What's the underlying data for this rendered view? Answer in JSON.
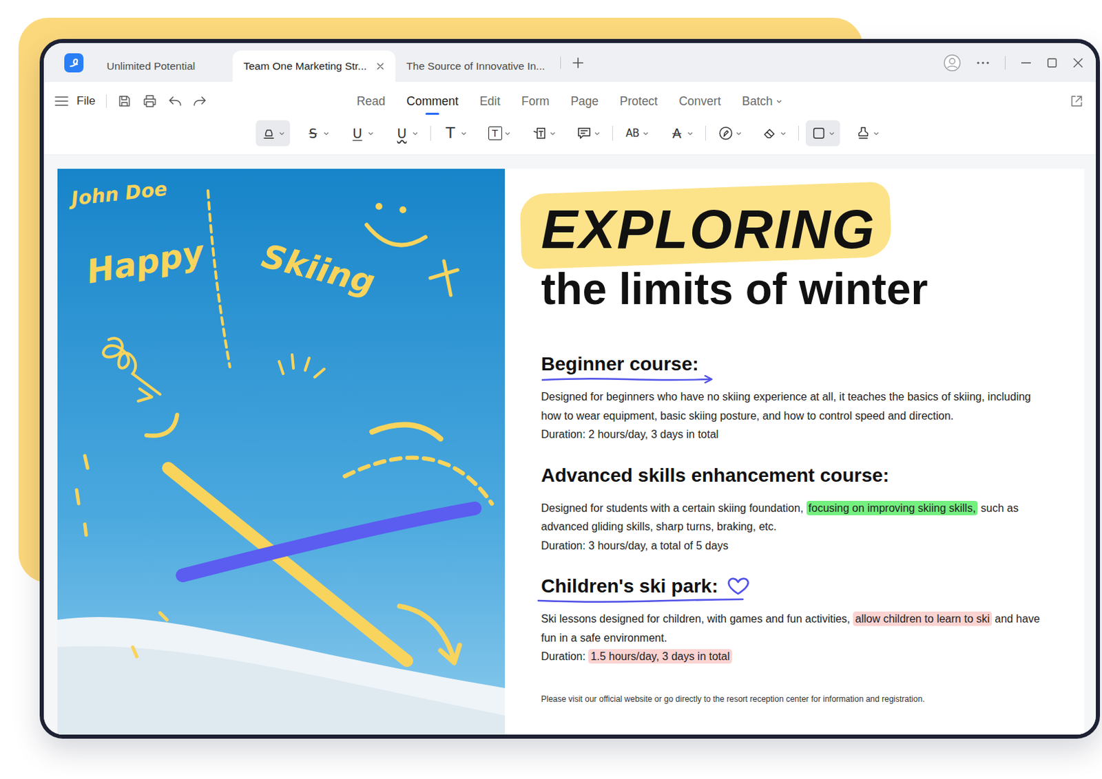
{
  "tabs": [
    {
      "label": "Unlimited Potential",
      "selected": false,
      "closable": false
    },
    {
      "label": "Team One Marketing Str...",
      "selected": true,
      "closable": true
    },
    {
      "label": "The Source of Innovative In...",
      "selected": false,
      "closable": false
    }
  ],
  "file_menu": {
    "label": "File"
  },
  "menus": [
    {
      "label": "Read",
      "selected": false,
      "dropdown": false
    },
    {
      "label": "Comment",
      "selected": true,
      "dropdown": false
    },
    {
      "label": "Edit",
      "selected": false,
      "dropdown": false
    },
    {
      "label": "Form",
      "selected": false,
      "dropdown": false
    },
    {
      "label": "Page",
      "selected": false,
      "dropdown": false
    },
    {
      "label": "Protect",
      "selected": false,
      "dropdown": false
    },
    {
      "label": "Convert",
      "selected": false,
      "dropdown": false
    },
    {
      "label": "Batch",
      "selected": false,
      "dropdown": true
    }
  ],
  "tool_groups": [
    [
      {
        "kind": "highlight",
        "selected": true
      },
      {
        "kind": "strikethrough",
        "glyph": "S",
        "selected": false
      },
      {
        "kind": "underline",
        "glyph": "U",
        "selected": false
      },
      {
        "kind": "squiggly",
        "glyph": "U",
        "selected": false
      }
    ],
    [
      {
        "kind": "text",
        "glyph": "T",
        "selected": false
      },
      {
        "kind": "textbox",
        "glyph": "T",
        "selected": false
      },
      {
        "kind": "callout",
        "selected": false
      },
      {
        "kind": "note",
        "selected": false
      }
    ],
    [
      {
        "kind": "replace",
        "glyph": "AB",
        "selected": false
      },
      {
        "kind": "font",
        "glyph": "A",
        "selected": false
      }
    ],
    [
      {
        "kind": "pencil",
        "selected": false
      },
      {
        "kind": "eraser",
        "selected": false
      }
    ],
    [
      {
        "kind": "shape",
        "selected": true
      },
      {
        "kind": "stamp",
        "selected": false
      }
    ]
  ],
  "document": {
    "ink": {
      "signature": "John Doe",
      "words": [
        "Happy",
        "Skiing"
      ]
    },
    "title": "EXPLORING",
    "subtitle": "the limits of winter",
    "sections": [
      {
        "heading": "Beginner course:",
        "mark": "arrow-underline",
        "body": [
          {
            "text": "Designed for beginners who have no skiing experience at all, it teaches the basics of skiing, including how to wear equipment, basic skiing posture, and how to control speed and direction.",
            "highlighted": false
          }
        ],
        "duration": [
          {
            "text": "Duration: 2 hours/day, 3 days in total",
            "highlighted": false
          }
        ]
      },
      {
        "heading": "Advanced skills enhancement course:",
        "mark": "none",
        "body": [
          {
            "text": "Designed for students with a certain skiing foundation, ",
            "highlighted": false
          },
          {
            "text": "focusing on improving skiing skills,",
            "highlighted": true,
            "color": "#74f07f"
          },
          {
            "text": " such as advanced gliding skills, sharp turns, braking, etc.",
            "highlighted": false
          }
        ],
        "duration": [
          {
            "text": "Duration: 3 hours/day, a total of 5 days",
            "highlighted": false
          }
        ]
      },
      {
        "heading": "Children's ski park:",
        "mark": "heart-underline",
        "body": [
          {
            "text": "Ski lessons designed for children, with games and fun activities, ",
            "highlighted": false
          },
          {
            "text": "allow children to learn to ski",
            "highlighted": true,
            "color": "#fbd3d1"
          },
          {
            "text": " and have fun in a safe environment.",
            "highlighted": false
          }
        ],
        "duration": [
          {
            "text": "Duration: ",
            "highlighted": false
          },
          {
            "text": "1.5 hours/day, 3 days in total",
            "highlighted": true,
            "color": "#fbd3d1"
          }
        ]
      }
    ],
    "footer": "Please visit our official website or go directly to the resort reception center for information and registration."
  }
}
